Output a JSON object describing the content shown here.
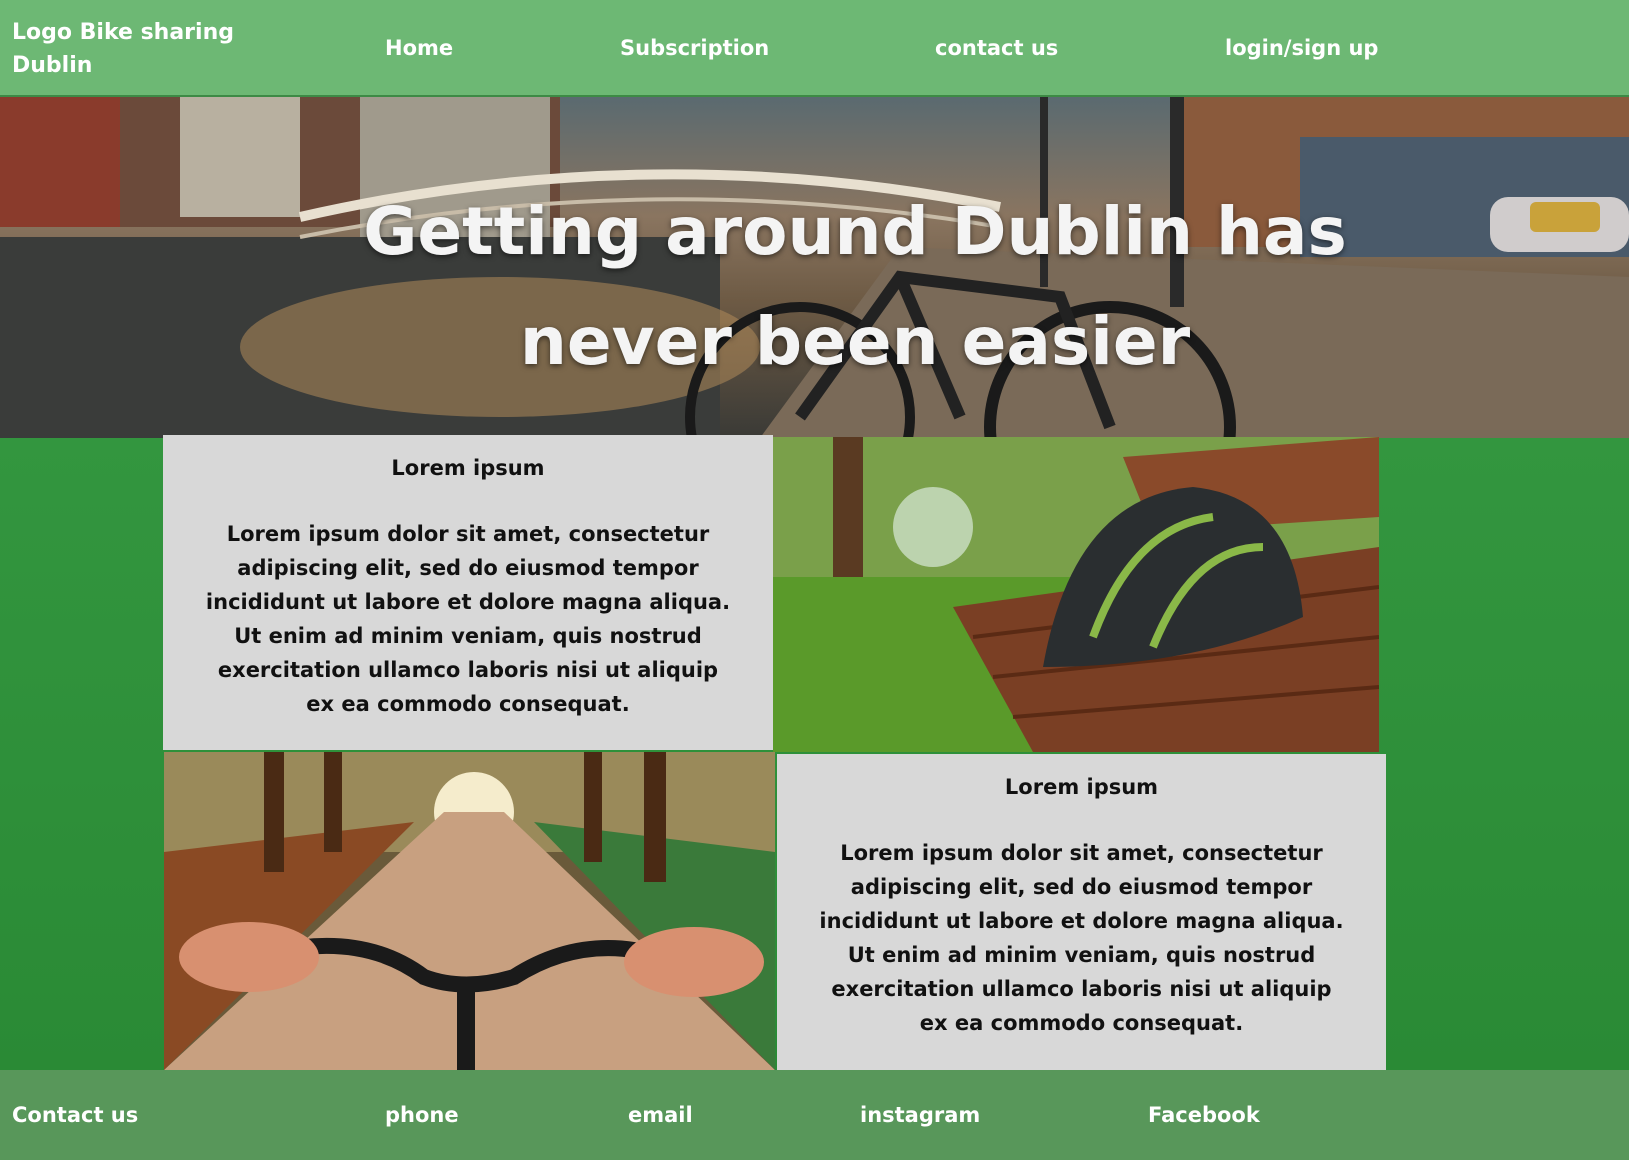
{
  "header": {
    "logo_text": "Logo Bike sharing Dublin",
    "nav": [
      "Home",
      "Subscription",
      "contact us",
      "login/sign up"
    ]
  },
  "hero": {
    "title": "Getting around Dublin has never been easier"
  },
  "cards": [
    {
      "title": "Lorem ipsum",
      "body": "Lorem ipsum dolor sit amet, consectetur adipiscing elit, sed do eiusmod tempor incididunt ut labore et dolore magna aliqua. Ut enim ad minim veniam, quis nostrud exercitation ullamco laboris nisi ut aliquip ex ea commodo consequat."
    },
    {
      "title": "Lorem ipsum",
      "body": "Lorem ipsum dolor sit amet, consectetur adipiscing elit, sed do eiusmod tempor incididunt ut labore et dolore magna aliqua. Ut enim ad minim veniam, quis nostrud exercitation ullamco laboris nisi ut aliquip ex ea commodo consequat."
    }
  ],
  "images": {
    "hero": "dublin-river-bridge-bicycle-photo",
    "helmet": "bike-helmet-on-park-bench-photo",
    "handlebars": "bicycle-handlebars-park-path-photo"
  },
  "footer": {
    "contact_label": "Contact us",
    "links": [
      "phone",
      "email",
      "instagram",
      "Facebook"
    ]
  },
  "colors": {
    "header_bg": "#6db874",
    "main_bg": "#2e8b3a",
    "card_bg": "#d8d8d8",
    "footer_bg": "#58975a",
    "text_light": "#ffffff"
  }
}
